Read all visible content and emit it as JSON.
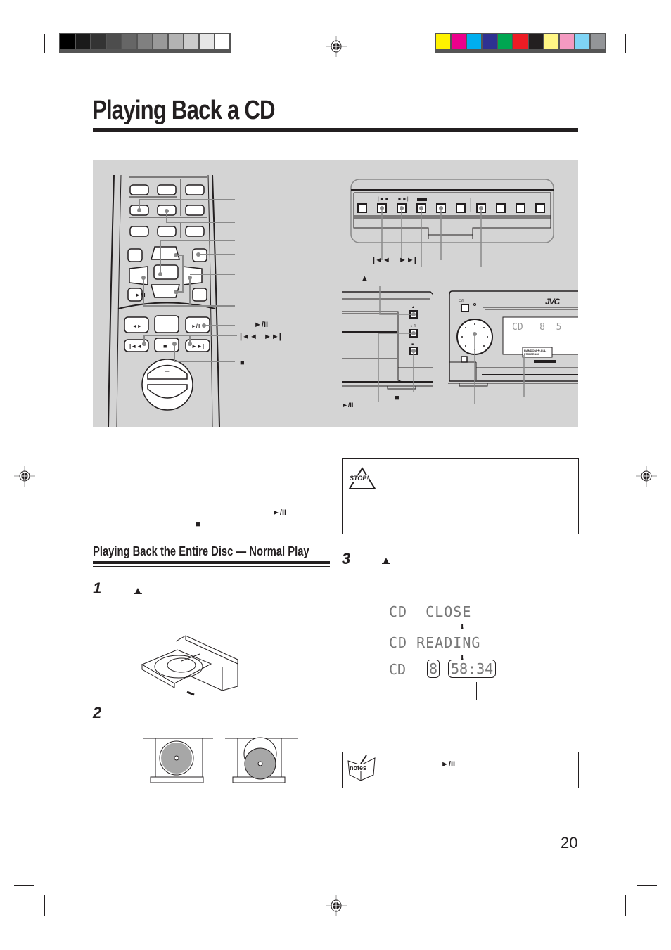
{
  "page": {
    "title": "Playing Back a CD",
    "page_number": "20",
    "section_heading": "Playing Back the Entire Disc — Normal Play"
  },
  "registration": {
    "gray_swatches": [
      "#000000",
      "#1a1a1a",
      "#333333",
      "#4d4d4d",
      "#666666",
      "#808080",
      "#999999",
      "#b3b3b3",
      "#cccccc",
      "#e6e6e6",
      "#ffffff"
    ],
    "color_swatches": [
      "#fff200",
      "#ec008c",
      "#00aeef",
      "#2e3192",
      "#00a651",
      "#ed1c24",
      "#231f20",
      "#fff685",
      "#f49ac1",
      "#7fd4f5",
      "#939598"
    ]
  },
  "figure": {
    "remote_labels": {
      "play_pause": "►/II",
      "skip": "|◄◄   ►►|",
      "stop": "■"
    },
    "panel_labels": {
      "skip_back": "|◄◄",
      "skip_fwd": "►►|",
      "eject": "▲",
      "stop": "■",
      "play_pause": "►/II"
    },
    "unit": {
      "brand": "JVC",
      "display_text": "CD   8  5",
      "mode_label_1": "RANDOM ⟲ ALL",
      "mode_label_2": "PROGRAM",
      "power_label": "⏻/I"
    }
  },
  "left_column": {
    "play_pause_symbol": "►/II",
    "stop_symbol": "■",
    "steps": [
      {
        "number": "1",
        "symbol": "▲"
      },
      {
        "number": "2",
        "symbol": ""
      }
    ]
  },
  "right_column": {
    "stop_box_icon": "STOP!",
    "step3": {
      "number": "3",
      "symbol": "▲"
    },
    "display_sequence": [
      "CD  CLOSE",
      "CD READING",
      "CD"
    ],
    "track_number": "8",
    "total_time": "58:34",
    "notes_icon": "notes",
    "notes_symbol": "►/II"
  }
}
